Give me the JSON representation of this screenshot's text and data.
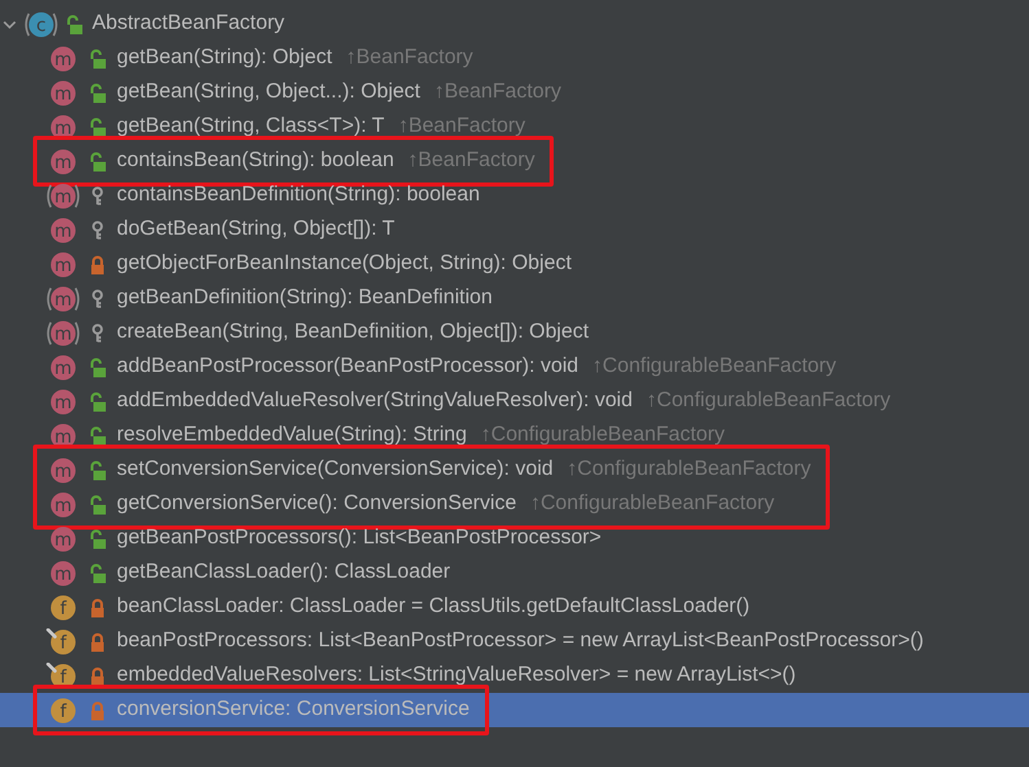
{
  "tree": {
    "label": "AbstractBeanFactory",
    "kind": "class",
    "icon_letter": "c",
    "abstract": true,
    "access": {
      "kind": "public"
    },
    "expanded": true,
    "children": [
      {
        "kind": "method",
        "icon_letter": "m",
        "abstract": false,
        "final": false,
        "access": {
          "kind": "public"
        },
        "label": "getBean(String): Object",
        "inherited": "↑BeanFactory",
        "boxed": false,
        "selected": false
      },
      {
        "kind": "method",
        "icon_letter": "m",
        "abstract": false,
        "final": false,
        "access": {
          "kind": "public"
        },
        "label": "getBean(String, Object...): Object",
        "inherited": "↑BeanFactory",
        "boxed": false,
        "selected": false
      },
      {
        "kind": "method",
        "icon_letter": "m",
        "abstract": false,
        "final": false,
        "access": {
          "kind": "public"
        },
        "label": "getBean(String, Class<T>): T",
        "inherited": "↑BeanFactory",
        "boxed": false,
        "selected": false
      },
      {
        "kind": "method",
        "icon_letter": "m",
        "abstract": false,
        "final": false,
        "access": {
          "kind": "public"
        },
        "label": "containsBean(String): boolean",
        "inherited": "↑BeanFactory",
        "boxed": true,
        "selected": false
      },
      {
        "kind": "method",
        "icon_letter": "m",
        "abstract": true,
        "final": false,
        "access": {
          "kind": "protected"
        },
        "label": "containsBeanDefinition(String): boolean",
        "boxed": false,
        "selected": false
      },
      {
        "kind": "method",
        "icon_letter": "m",
        "abstract": false,
        "final": false,
        "access": {
          "kind": "protected"
        },
        "label": "doGetBean(String, Object[]): T",
        "boxed": false,
        "selected": false
      },
      {
        "kind": "method",
        "icon_letter": "m",
        "abstract": false,
        "final": false,
        "access": {
          "kind": "private"
        },
        "label": "getObjectForBeanInstance(Object, String): Object",
        "boxed": false,
        "selected": false
      },
      {
        "kind": "method",
        "icon_letter": "m",
        "abstract": true,
        "final": false,
        "access": {
          "kind": "protected"
        },
        "label": "getBeanDefinition(String): BeanDefinition",
        "boxed": false,
        "selected": false
      },
      {
        "kind": "method",
        "icon_letter": "m",
        "abstract": true,
        "final": false,
        "access": {
          "kind": "protected"
        },
        "label": "createBean(String, BeanDefinition, Object[]): Object",
        "boxed": false,
        "selected": false
      },
      {
        "kind": "method",
        "icon_letter": "m",
        "abstract": false,
        "final": false,
        "access": {
          "kind": "public"
        },
        "label": "addBeanPostProcessor(BeanPostProcessor): void",
        "inherited": "↑ConfigurableBeanFactory",
        "boxed": false,
        "selected": false
      },
      {
        "kind": "method",
        "icon_letter": "m",
        "abstract": false,
        "final": false,
        "access": {
          "kind": "public"
        },
        "label": "addEmbeddedValueResolver(StringValueResolver): void",
        "inherited": "↑ConfigurableBeanFactory",
        "boxed": false,
        "selected": false
      },
      {
        "kind": "method",
        "icon_letter": "m",
        "abstract": false,
        "final": false,
        "access": {
          "kind": "public"
        },
        "label": "resolveEmbeddedValue(String): String",
        "inherited": "↑ConfigurableBeanFactory",
        "boxed": false,
        "selected": false
      },
      {
        "kind": "method",
        "icon_letter": "m",
        "abstract": false,
        "final": false,
        "access": {
          "kind": "public"
        },
        "label": "setConversionService(ConversionService): void",
        "inherited": "↑ConfigurableBeanFactory",
        "boxed": true,
        "selected": false
      },
      {
        "kind": "method",
        "icon_letter": "m",
        "abstract": false,
        "final": false,
        "access": {
          "kind": "public"
        },
        "label": "getConversionService(): ConversionService",
        "inherited": "↑ConfigurableBeanFactory",
        "boxed": true,
        "selected": false
      },
      {
        "kind": "method",
        "icon_letter": "m",
        "abstract": false,
        "final": false,
        "access": {
          "kind": "public"
        },
        "label": "getBeanPostProcessors(): List<BeanPostProcessor>",
        "boxed": false,
        "selected": false
      },
      {
        "kind": "method",
        "icon_letter": "m",
        "abstract": false,
        "final": false,
        "access": {
          "kind": "public"
        },
        "label": "getBeanClassLoader(): ClassLoader",
        "boxed": false,
        "selected": false
      },
      {
        "kind": "field",
        "icon_letter": "f",
        "abstract": false,
        "final": false,
        "access": {
          "kind": "private"
        },
        "label": "beanClassLoader: ClassLoader = ClassUtils.getDefaultClassLoader()",
        "boxed": false,
        "selected": false
      },
      {
        "kind": "field",
        "icon_letter": "f",
        "abstract": false,
        "final": true,
        "access": {
          "kind": "private"
        },
        "label": "beanPostProcessors: List<BeanPostProcessor> = new ArrayList<BeanPostProcessor>()",
        "boxed": false,
        "selected": false
      },
      {
        "kind": "field",
        "icon_letter": "f",
        "abstract": false,
        "final": true,
        "access": {
          "kind": "private"
        },
        "label": "embeddedValueResolvers: List<StringValueResolver> = new ArrayList<>()",
        "boxed": false,
        "selected": false
      },
      {
        "kind": "field",
        "icon_letter": "f",
        "abstract": false,
        "final": false,
        "access": {
          "kind": "private"
        },
        "label": "conversionService: ConversionService",
        "boxed": true,
        "selected": true
      }
    ]
  }
}
